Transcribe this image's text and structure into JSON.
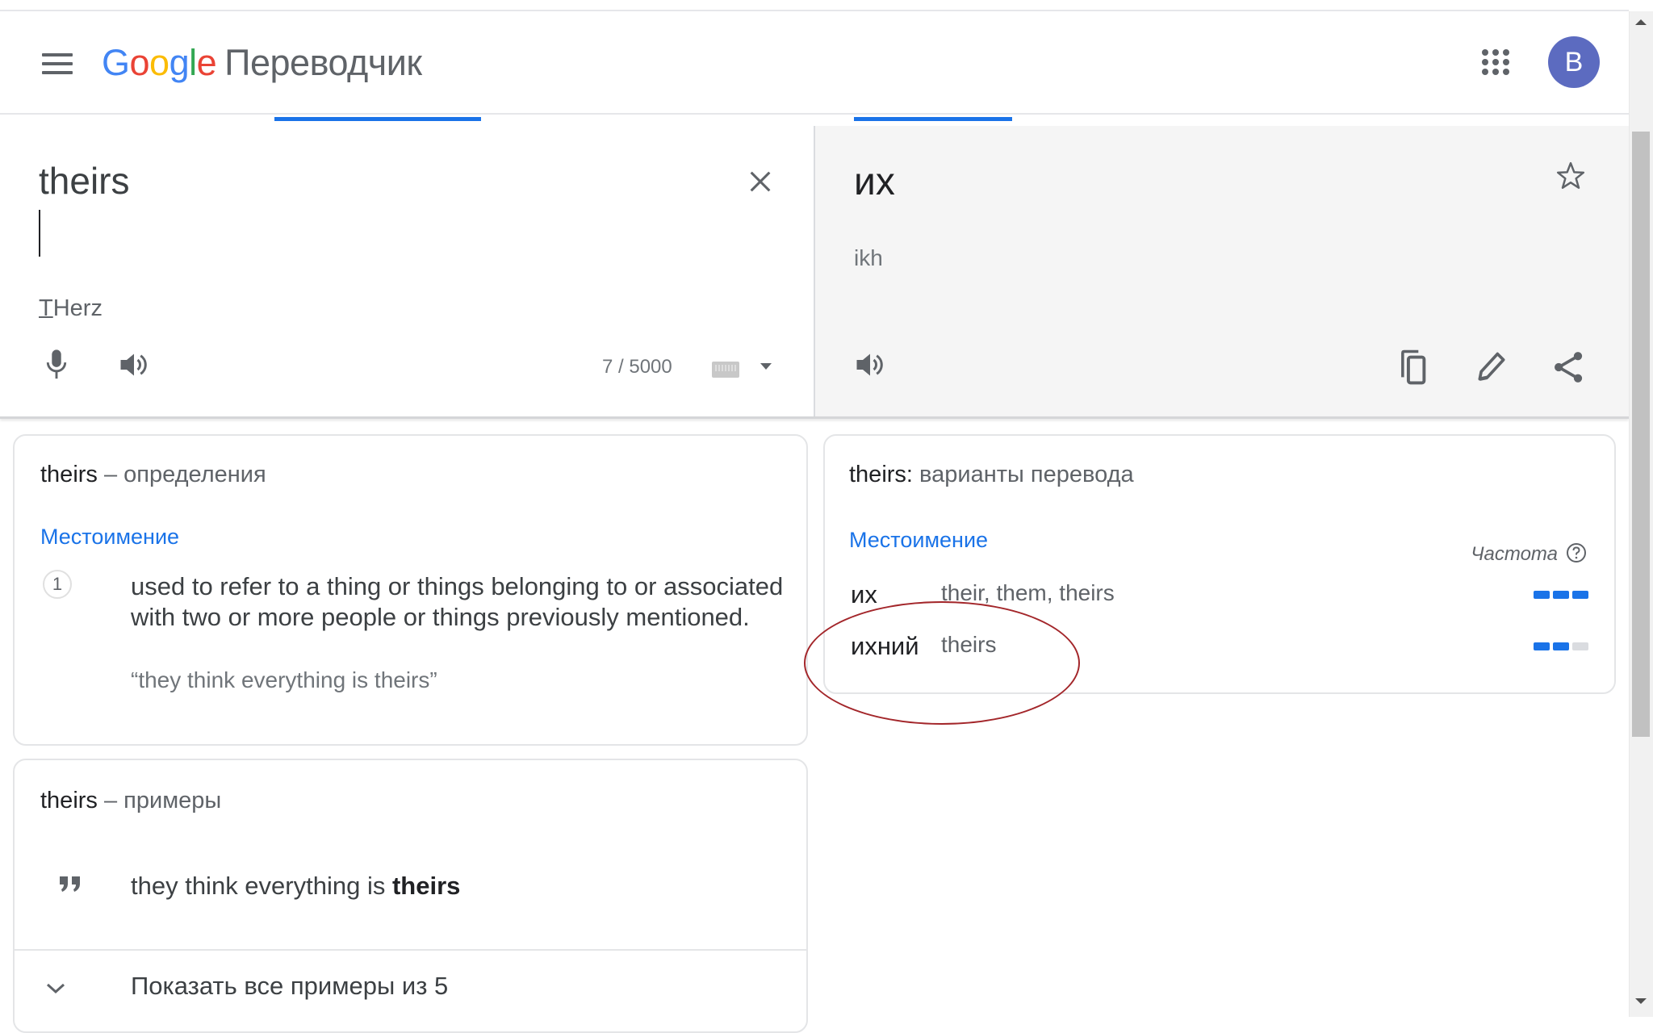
{
  "header": {
    "logo_letters": [
      "G",
      "o",
      "o",
      "g",
      "l",
      "e"
    ],
    "product_name": "Переводчик",
    "menu_icon": "hamburger-menu-icon",
    "apps_icon": "apps-grid-icon",
    "avatar_initial": "B",
    "avatar_color": "#5c6bc0"
  },
  "source": {
    "text": "theirs",
    "transliteration_first": "T",
    "transliteration_rest": "Herz",
    "char_count": "7 / 5000",
    "icons": [
      "clear-icon",
      "microphone-icon",
      "speaker-icon",
      "keyboard-icon",
      "dropdown-arrow-icon"
    ]
  },
  "target": {
    "text": "их",
    "transliteration": "ikh",
    "icons": [
      "star-icon",
      "speaker-icon",
      "copy-icon",
      "edit-icon",
      "share-icon"
    ]
  },
  "definitions": {
    "title_word": "theirs",
    "title_rest": " – определения",
    "part_of_speech": "Местоимение",
    "items": [
      {
        "number": "1",
        "text": "used to refer to a thing or things belonging to or associated with two or more people or things previously mentioned.",
        "example": "“they think everything is theirs”"
      }
    ]
  },
  "examples": {
    "title_word": "theirs",
    "title_rest": " – примеры",
    "items": [
      {
        "text_before": "they think everything is ",
        "highlight": "theirs"
      }
    ],
    "show_all_label": "Показать все примеры из 5"
  },
  "alternatives": {
    "title_word": "theirs:",
    "title_rest": " варианты перевода",
    "part_of_speech": "Местоимение",
    "frequency_label": "Частота",
    "rows": [
      {
        "word": "их",
        "back_translations": "their, them, theirs",
        "frequency": 3,
        "frequency_max": 3
      },
      {
        "word": "ихний",
        "back_translations": "theirs",
        "frequency": 2,
        "frequency_max": 3
      }
    ]
  },
  "colors": {
    "accent": "#1a73e8",
    "annotation": "#a3262a",
    "freq_on": "#1a73e8",
    "freq_off": "#dadce0"
  }
}
